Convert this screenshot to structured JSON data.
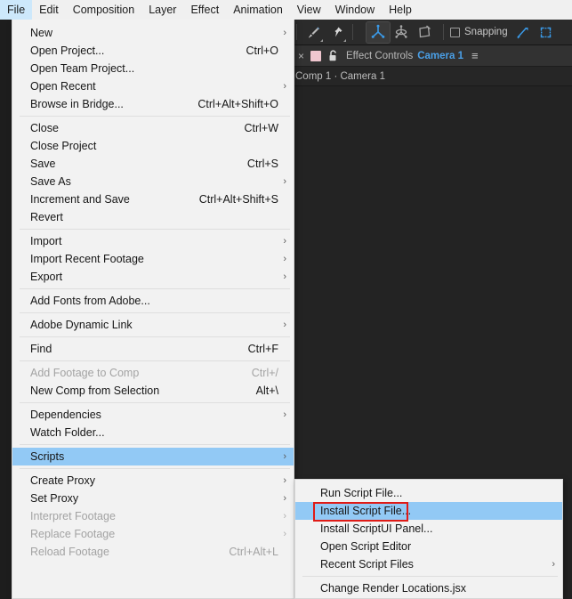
{
  "menubar": {
    "items": [
      {
        "label": "File",
        "active": true
      },
      {
        "label": "Edit",
        "active": false
      },
      {
        "label": "Composition",
        "active": false
      },
      {
        "label": "Layer",
        "active": false
      },
      {
        "label": "Effect",
        "active": false
      },
      {
        "label": "Animation",
        "active": false
      },
      {
        "label": "View",
        "active": false
      },
      {
        "label": "Window",
        "active": false
      },
      {
        "label": "Help",
        "active": false
      }
    ]
  },
  "toolbar": {
    "buttons": [
      {
        "name": "brush-tool",
        "selected": false,
        "has_corner": true
      },
      {
        "name": "puppet-pin-tool",
        "selected": false,
        "has_corner": true
      },
      {
        "name": "universal-camera-tool",
        "selected": true,
        "has_corner": false
      },
      {
        "name": "orbit-tool",
        "selected": false,
        "has_corner": false
      },
      {
        "name": "rotate-camera-tool",
        "selected": false,
        "has_corner": false
      }
    ],
    "snapping_label": "Snapping",
    "snapping_checked": false,
    "extra_buttons": [
      {
        "name": "snapping-options-icon"
      },
      {
        "name": "region-of-interest-icon"
      }
    ]
  },
  "panel": {
    "close_glyph": "×",
    "swatch_color": "#f0c6cf",
    "lock_icon": "lock-icon",
    "title": "Effect Controls",
    "target": "Camera 1",
    "menu_glyph": "≡",
    "breadcrumb": "Comp 1 · Camera 1"
  },
  "file_menu": {
    "items": [
      {
        "type": "item",
        "label": "New",
        "accel": "",
        "arrow": true,
        "disabled": false,
        "highlighted": false
      },
      {
        "type": "item",
        "label": "Open Project...",
        "accel": "Ctrl+O",
        "arrow": false,
        "disabled": false,
        "highlighted": false
      },
      {
        "type": "item",
        "label": "Open Team Project...",
        "accel": "",
        "arrow": false,
        "disabled": false,
        "highlighted": false
      },
      {
        "type": "item",
        "label": "Open Recent",
        "accel": "",
        "arrow": true,
        "disabled": false,
        "highlighted": false
      },
      {
        "type": "item",
        "label": "Browse in Bridge...",
        "accel": "Ctrl+Alt+Shift+O",
        "arrow": false,
        "disabled": false,
        "highlighted": false
      },
      {
        "type": "sep"
      },
      {
        "type": "item",
        "label": "Close",
        "accel": "Ctrl+W",
        "arrow": false,
        "disabled": false,
        "highlighted": false
      },
      {
        "type": "item",
        "label": "Close Project",
        "accel": "",
        "arrow": false,
        "disabled": false,
        "highlighted": false
      },
      {
        "type": "item",
        "label": "Save",
        "accel": "Ctrl+S",
        "arrow": false,
        "disabled": false,
        "highlighted": false
      },
      {
        "type": "item",
        "label": "Save As",
        "accel": "",
        "arrow": true,
        "disabled": false,
        "highlighted": false
      },
      {
        "type": "item",
        "label": "Increment and Save",
        "accel": "Ctrl+Alt+Shift+S",
        "arrow": false,
        "disabled": false,
        "highlighted": false
      },
      {
        "type": "item",
        "label": "Revert",
        "accel": "",
        "arrow": false,
        "disabled": false,
        "highlighted": false
      },
      {
        "type": "sep"
      },
      {
        "type": "item",
        "label": "Import",
        "accel": "",
        "arrow": true,
        "disabled": false,
        "highlighted": false
      },
      {
        "type": "item",
        "label": "Import Recent Footage",
        "accel": "",
        "arrow": true,
        "disabled": false,
        "highlighted": false
      },
      {
        "type": "item",
        "label": "Export",
        "accel": "",
        "arrow": true,
        "disabled": false,
        "highlighted": false
      },
      {
        "type": "sep"
      },
      {
        "type": "item",
        "label": "Add Fonts from Adobe...",
        "accel": "",
        "arrow": false,
        "disabled": false,
        "highlighted": false
      },
      {
        "type": "sep"
      },
      {
        "type": "item",
        "label": "Adobe Dynamic Link",
        "accel": "",
        "arrow": true,
        "disabled": false,
        "highlighted": false
      },
      {
        "type": "sep"
      },
      {
        "type": "item",
        "label": "Find",
        "accel": "Ctrl+F",
        "arrow": false,
        "disabled": false,
        "highlighted": false
      },
      {
        "type": "sep"
      },
      {
        "type": "item",
        "label": "Add Footage to Comp",
        "accel": "Ctrl+/",
        "arrow": false,
        "disabled": true,
        "highlighted": false
      },
      {
        "type": "item",
        "label": "New Comp from Selection",
        "accel": "Alt+\\",
        "arrow": false,
        "disabled": false,
        "highlighted": false
      },
      {
        "type": "sep"
      },
      {
        "type": "item",
        "label": "Dependencies",
        "accel": "",
        "arrow": true,
        "disabled": false,
        "highlighted": false
      },
      {
        "type": "item",
        "label": "Watch Folder...",
        "accel": "",
        "arrow": false,
        "disabled": false,
        "highlighted": false
      },
      {
        "type": "sep"
      },
      {
        "type": "item",
        "label": "Scripts",
        "accel": "",
        "arrow": true,
        "disabled": false,
        "highlighted": true
      },
      {
        "type": "sep"
      },
      {
        "type": "item",
        "label": "Create Proxy",
        "accel": "",
        "arrow": true,
        "disabled": false,
        "highlighted": false
      },
      {
        "type": "item",
        "label": "Set Proxy",
        "accel": "",
        "arrow": true,
        "disabled": false,
        "highlighted": false
      },
      {
        "type": "item",
        "label": "Interpret Footage",
        "accel": "",
        "arrow": true,
        "disabled": true,
        "highlighted": false
      },
      {
        "type": "item",
        "label": "Replace Footage",
        "accel": "",
        "arrow": true,
        "disabled": true,
        "highlighted": false
      },
      {
        "type": "item",
        "label": "Reload Footage",
        "accel": "Ctrl+Alt+L",
        "arrow": false,
        "disabled": true,
        "highlighted": false
      }
    ]
  },
  "scripts_submenu": {
    "items": [
      {
        "type": "item",
        "label": "Run Script File...",
        "accel": "",
        "arrow": false,
        "disabled": false,
        "highlighted": false
      },
      {
        "type": "item",
        "label": "Install Script File...",
        "accel": "",
        "arrow": false,
        "disabled": false,
        "highlighted": true
      },
      {
        "type": "item",
        "label": "Install ScriptUI Panel...",
        "accel": "",
        "arrow": false,
        "disabled": false,
        "highlighted": false
      },
      {
        "type": "item",
        "label": "Open Script Editor",
        "accel": "",
        "arrow": false,
        "disabled": false,
        "highlighted": false
      },
      {
        "type": "item",
        "label": "Recent Script Files",
        "accel": "",
        "arrow": true,
        "disabled": false,
        "highlighted": false
      },
      {
        "type": "sep"
      },
      {
        "type": "item",
        "label": "Change Render Locations.jsx",
        "accel": "",
        "arrow": false,
        "disabled": false,
        "highlighted": false
      }
    ]
  },
  "annotation": {
    "color": "#e01b16",
    "target_label": "Install Script File..."
  }
}
